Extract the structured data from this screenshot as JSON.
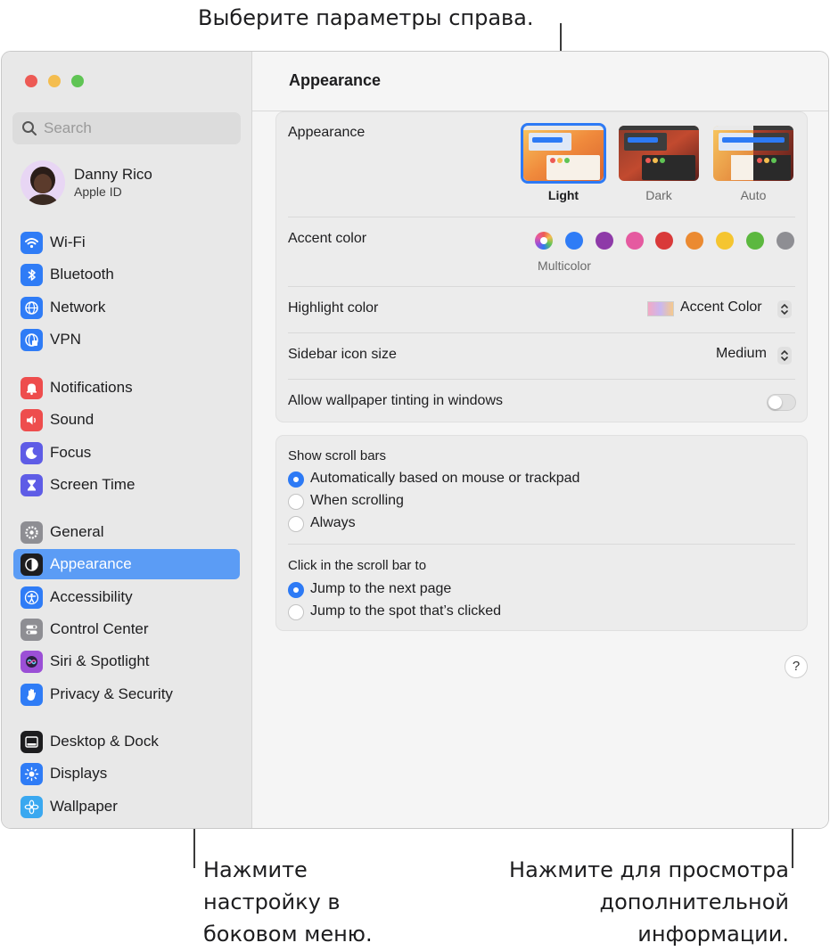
{
  "callouts": {
    "top": "Выберите параметры справа.",
    "left": [
      "Нажмите",
      "настройку в",
      "боковом меню."
    ],
    "right": [
      "Нажмите для просмотра",
      "дополнительной",
      "информации."
    ]
  },
  "search": {
    "placeholder": "Search"
  },
  "profile": {
    "name": "Danny Rico",
    "subtitle": "Apple ID"
  },
  "sidebar": {
    "groups": [
      [
        {
          "label": "Wi-Fi",
          "icon": "wifi-icon",
          "color": "#2f7cf6"
        },
        {
          "label": "Bluetooth",
          "icon": "bluetooth-icon",
          "color": "#2f7cf6"
        },
        {
          "label": "Network",
          "icon": "globe-icon",
          "color": "#2f7cf6"
        },
        {
          "label": "VPN",
          "icon": "vpn-globe-icon",
          "color": "#2f7cf6"
        }
      ],
      [
        {
          "label": "Notifications",
          "icon": "bell-icon",
          "color": "#ee4d4d"
        },
        {
          "label": "Sound",
          "icon": "speaker-icon",
          "color": "#ee4d4d"
        },
        {
          "label": "Focus",
          "icon": "moon-icon",
          "color": "#5e5ce6"
        },
        {
          "label": "Screen Time",
          "icon": "hourglass-icon",
          "color": "#5e5ce6"
        }
      ],
      [
        {
          "label": "General",
          "icon": "gear-icon",
          "color": "#8e8e93"
        },
        {
          "label": "Appearance",
          "icon": "appearance-icon",
          "color": "#1d1d1f",
          "active": true
        },
        {
          "label": "Accessibility",
          "icon": "accessibility-icon",
          "color": "#2f7cf6"
        },
        {
          "label": "Control Center",
          "icon": "toggles-icon",
          "color": "#8e8e93"
        },
        {
          "label": "Siri & Spotlight",
          "icon": "siri-icon",
          "color": "#9b4fd6"
        },
        {
          "label": "Privacy & Security",
          "icon": "hand-icon",
          "color": "#2f7cf6"
        }
      ],
      [
        {
          "label": "Desktop & Dock",
          "icon": "dock-icon",
          "color": "#1d1d1f"
        },
        {
          "label": "Displays",
          "icon": "sun-icon",
          "color": "#2f7cf6"
        },
        {
          "label": "Wallpaper",
          "icon": "flower-icon",
          "color": "#3aa8f0"
        }
      ]
    ]
  },
  "main": {
    "title": "Appearance",
    "appearance": {
      "label": "Appearance",
      "options": [
        "Light",
        "Dark",
        "Auto"
      ],
      "selected": "Light"
    },
    "accent": {
      "label": "Accent color",
      "selected_name": "Multicolor",
      "colors": [
        "#2f7cf6",
        "#8e3aa8",
        "#e55aa0",
        "#d93a3a",
        "#eb8a31",
        "#f5c530",
        "#5cb83f",
        "#8e8e93"
      ]
    },
    "highlight": {
      "label": "Highlight color",
      "value": "Accent Color"
    },
    "sidebar_icon": {
      "label": "Sidebar icon size",
      "value": "Medium"
    },
    "tinting": {
      "label": "Allow wallpaper tinting in windows",
      "on": false
    },
    "scroll": {
      "label": "Show scroll bars",
      "options": [
        "Automatically based on mouse or trackpad",
        "When scrolling",
        "Always"
      ],
      "selected": 0
    },
    "click": {
      "label": "Click in the scroll bar to",
      "options": [
        "Jump to the next page",
        "Jump to the spot that’s clicked"
      ],
      "selected": 0
    },
    "help": "?"
  }
}
